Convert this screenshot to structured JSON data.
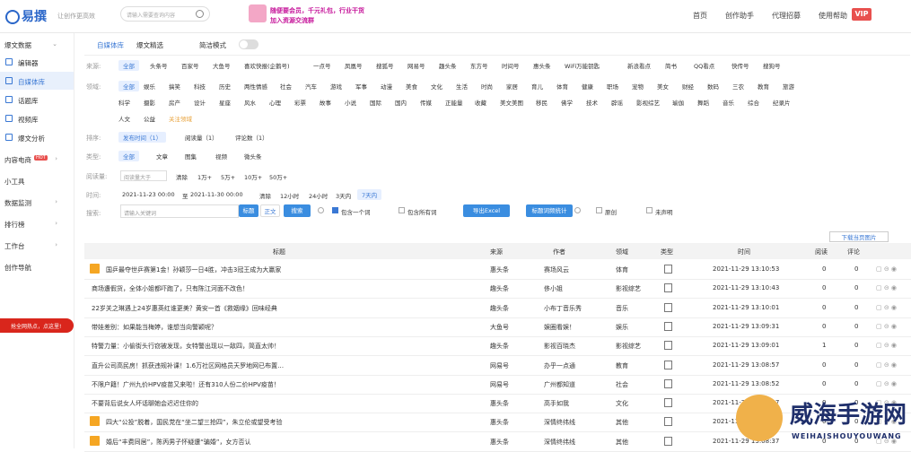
{
  "header": {
    "logo": "易撰",
    "slogan": "让创作更高效",
    "search_placeholder": "请输入需要查询内容",
    "banner_line1": "随便要会员，千元礼包，行业干货",
    "banner_line2": "加入资源交流群",
    "nav": [
      "首页",
      "创作助手",
      "代理招募",
      "使用帮助"
    ],
    "vip": "VIP"
  },
  "sidebar": {
    "items": [
      {
        "label": "爆文数据",
        "arrow": "⌄"
      },
      {
        "label": "编辑器"
      },
      {
        "label": "自媒体库"
      },
      {
        "label": "话题库"
      },
      {
        "label": "视频库"
      },
      {
        "label": "爆文分析"
      },
      {
        "label": "内容电商",
        "badge": "HOT",
        "arrow": "›"
      },
      {
        "label": "小工具"
      },
      {
        "label": "数据监测",
        "arrow": "›"
      },
      {
        "label": "排行榜",
        "arrow": "›"
      },
      {
        "label": "工作台",
        "arrow": "›"
      },
      {
        "label": "创作导航"
      }
    ],
    "promo": "抢全网热点，点这里!"
  },
  "tabs": {
    "t1": "自媒体库",
    "t2": "爆文精选",
    "t3": "简洁模式"
  },
  "filters": {
    "source_label": "来源:",
    "sources": [
      "全部",
      "头条号",
      "百家号",
      "大鱼号",
      "喜欢快报(企鹅号)",
      "一点号",
      "凤凰号",
      "搜狐号",
      "网易号",
      "趣头条",
      "东方号",
      "时间号",
      "惠头条",
      "WiFi万能钥匙",
      "新浪看点",
      "简书",
      "QQ看点",
      "快传号",
      "搜狗号"
    ],
    "domain_label": "领域:",
    "domains1": [
      "全部",
      "娱乐",
      "搞笑",
      "科技",
      "历史",
      "两性情感",
      "社会",
      "汽车",
      "游戏",
      "军事",
      "动漫",
      "美食",
      "文化",
      "生活",
      "时尚",
      "家居",
      "育儿",
      "体育",
      "健康",
      "职场",
      "宠物",
      "美女",
      "财经",
      "数码",
      "三农",
      "教育",
      "旅游"
    ],
    "domains2": [
      "科学",
      "摄影",
      "房产",
      "设计",
      "星座",
      "风水",
      "心理",
      "彩票",
      "故事",
      "小说",
      "国际",
      "国内",
      "传媒",
      "正能量",
      "收藏",
      "美文美图",
      "移民",
      "佛学",
      "技术",
      "辟谣",
      "影视综艺",
      "瑜伽",
      "舞蹈",
      "音乐",
      "综合",
      "纪录片"
    ],
    "domains3": [
      "人文",
      "公益",
      "关注领域"
    ],
    "sort_label": "排序:",
    "sorts": [
      "发布时间（1）",
      "阅读量（1）",
      "评论数（1）"
    ],
    "type_label": "类型:",
    "types": [
      "全部",
      "文章",
      "图集",
      "视频",
      "微头条"
    ],
    "read_label": "阅读量:",
    "read_placeholder": "阅读量大于",
    "read_opts": [
      "清除",
      "1万+",
      "5万+",
      "10万+",
      "50万+"
    ],
    "time_label": "时间:",
    "time_start": "2021-11-23 00:00",
    "time_sep": "至",
    "time_end": "2021-11-30 00:00",
    "time_opts": [
      "清除",
      "12小时",
      "24小时",
      "3天内",
      "7天内"
    ],
    "search_label": "搜索:",
    "search_placeholder": "请输入关键词",
    "title_btn": "标题",
    "body_btn": "正文",
    "search_btn": "搜索",
    "cb1": "包含一个词",
    "cb2": "包含所有词",
    "export_btn": "导出Excel",
    "stat_btn": "标题词频统计",
    "cb3": "原创",
    "cb4": "未声明"
  },
  "download_btn": "下载当页图片",
  "table": {
    "headers": [
      "标题",
      "来源",
      "作者",
      "领域",
      "类型",
      "时间",
      "阅读",
      "评论"
    ],
    "rows": [
      {
        "title": "国乒最夺世乒赛第1金！孙颖莎一日4胜，冲击3冠王成为大赢家",
        "source": "惠头条",
        "author": "赛场风云",
        "field": "体育",
        "time": "2021-11-29 13:10:53",
        "read": "0",
        "comment": "0"
      },
      {
        "title": "商场遭假货，全体小姐都吓跑了，只有陈江河面不改色！",
        "source": "趣头条",
        "author": "侈小姐",
        "field": "影视综艺",
        "time": "2021-11-29 13:10:43",
        "read": "0",
        "comment": "0"
      },
      {
        "title": "22岁关之琳遇上24岁惠英红谁更美？黄安一首《救姻缘》回味经典",
        "source": "趣头条",
        "author": "小布丁音乐秀",
        "field": "音乐",
        "time": "2021-11-29 13:10:01",
        "read": "0",
        "comment": "0"
      },
      {
        "title": "带娃差别：如果能当梅婷，谁想当向警颖呢？",
        "source": "大鱼号",
        "author": "娱圈看娱！",
        "field": "娱乐",
        "time": "2021-11-29 13:09:31",
        "read": "0",
        "comment": "0"
      },
      {
        "title": "特警力量：小偷街头行窃被发现，女特警出现以一敌四，简直太帅！",
        "source": "趣头条",
        "author": "影视百晓杰",
        "field": "影视综艺",
        "time": "2021-11-29 13:09:01",
        "read": "1",
        "comment": "0"
      },
      {
        "title": "直升公司高民房！抓获违规补课！1.6万社区网格员天罗地网已布置…",
        "source": "网易号",
        "author": "办乎一点通",
        "field": "教育",
        "time": "2021-11-29 13:08:57",
        "read": "0",
        "comment": "0"
      },
      {
        "title": "不限户籍！广州九价HPV疫苗又来啦！还有310人份二价HPV疫苗！",
        "source": "网易号",
        "author": "广州都知道",
        "field": "社会",
        "time": "2021-11-29 13:08:52",
        "read": "0",
        "comment": "0"
      },
      {
        "title": "不要背后说女人坏话聊她会迟迟住你的",
        "source": "惠头条",
        "author": "高手如我",
        "field": "文化",
        "time": "2021-11-29 13:08:47",
        "read": "0",
        "comment": "0"
      },
      {
        "title": "四大“公投”脱着，国民党在“坐二望三抢四”，朱立伦或望受考验",
        "source": "惠头条",
        "author": "深情终纬线",
        "field": "其他",
        "time": "2021-11-29 13:08:42",
        "read": "0",
        "comment": "0"
      },
      {
        "title": "婚后“丰费同居”，陈丙男子怀疑遭“骗婚”，女方否认",
        "source": "惠头条",
        "author": "深情终纬线",
        "field": "其他",
        "time": "2021-11-29 13:08:37",
        "read": "0",
        "comment": "0"
      }
    ]
  },
  "watermark": {
    "text": "威海手游网",
    "sub": "WEIHAISHOUYOUWANG"
  },
  "colors": {
    "accent": "#3a78d4",
    "brand_red": "#d9261c"
  }
}
